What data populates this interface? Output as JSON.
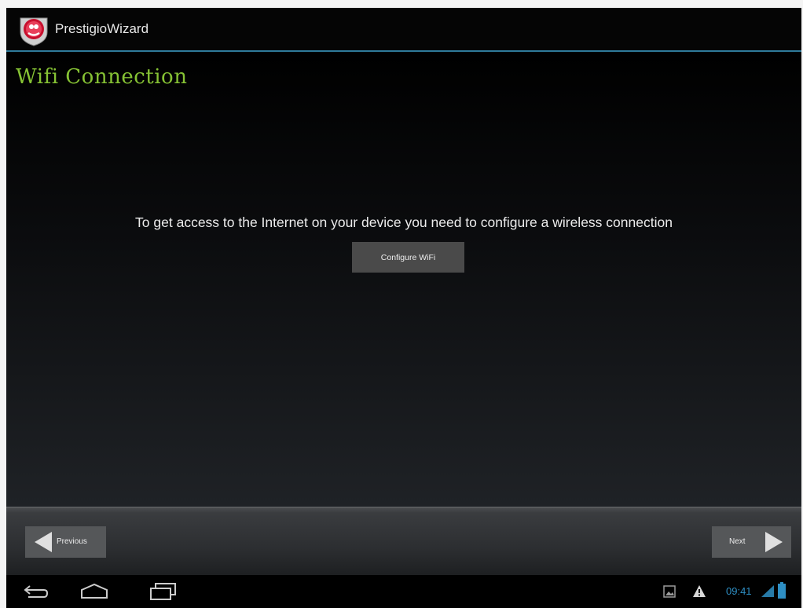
{
  "action_bar": {
    "app_title": "PrestigioWizard",
    "app_icon": "prestigio-logo-icon"
  },
  "main": {
    "page_title": "Wifi Connection",
    "instruction": "To get access to the Internet on your device you need to configure a wireless connection",
    "configure_button": "Configure WiFi"
  },
  "nav": {
    "previous_label": "Previous",
    "next_label": "Next"
  },
  "system_bar": {
    "clock": "09:41",
    "icons": [
      "back-icon",
      "home-icon",
      "recent-apps-icon",
      "gallery-notification-icon",
      "warning-icon",
      "signal-icon",
      "battery-icon"
    ]
  },
  "colors": {
    "title_green": "#86c234",
    "accent_blue": "#2f7a9a",
    "clock_blue": "#2e8fc4"
  }
}
